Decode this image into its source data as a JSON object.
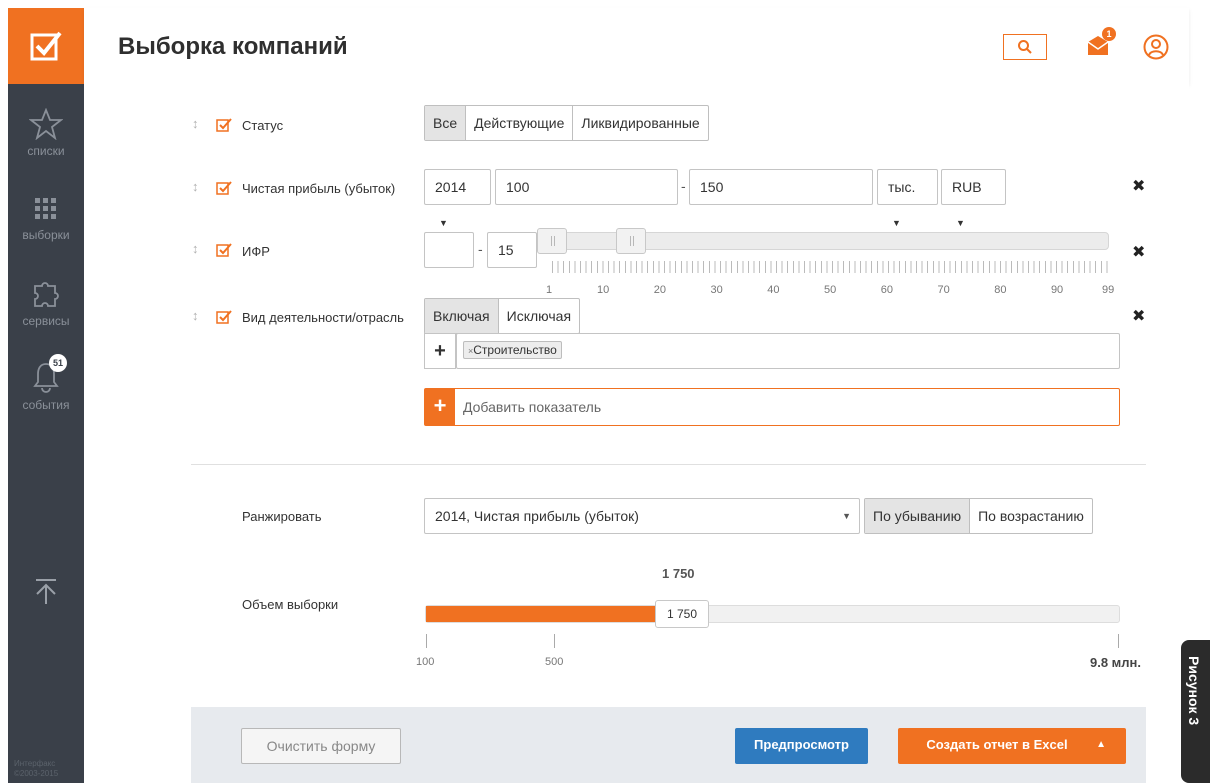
{
  "sidebar": {
    "items": [
      {
        "label": "списки",
        "icon": "star-icon"
      },
      {
        "label": "выборки",
        "icon": "grid-icon"
      },
      {
        "label": "сервисы",
        "icon": "puzzle-icon"
      },
      {
        "label": "события",
        "icon": "bell-icon",
        "badge": "51"
      }
    ],
    "footer_line1": "Интерфакс",
    "footer_line2": "©2003-2015"
  },
  "header": {
    "title": "Выборка компаний",
    "mail_badge": "1"
  },
  "filters": {
    "status": {
      "label": "Статус",
      "options": [
        "Все",
        "Действующие",
        "Ликвидированные"
      ],
      "selected": "Все"
    },
    "profit": {
      "label": "Чистая прибыль (убыток)",
      "year": "2014",
      "from": "100",
      "to": "150",
      "unit": "тыс.",
      "currency": "RUB"
    },
    "ifr": {
      "label": "ИФР",
      "from": "",
      "to": "15",
      "range_min": 1,
      "range_max": 99,
      "low": 1,
      "high": 15,
      "tick_labels": [
        "1",
        "10",
        "20",
        "30",
        "40",
        "50",
        "60",
        "70",
        "80",
        "90",
        "99"
      ]
    },
    "activity": {
      "label": "Вид деятельности/отрасль",
      "options": [
        "Включая",
        "Исключая"
      ],
      "selected": "Включая",
      "tags": [
        "Строительство"
      ]
    },
    "add_placeholder": "Добавить показатель"
  },
  "ranking": {
    "label": "Ранжировать",
    "selected": "2014, Чистая прибыль (убыток)",
    "order_options": [
      "По убыванию",
      "По возрастанию"
    ],
    "order_selected": "По убыванию"
  },
  "volume": {
    "label": "Объем выборки",
    "value": "1 750",
    "top_value": "1 750",
    "fill_fraction": 0.37,
    "min_label": "100",
    "mid_label": "500",
    "max_label": "9.8 млн."
  },
  "footer": {
    "clear_label": "Очистить форму",
    "preview_label": "Предпросмотр",
    "excel_label": "Создать отчет в Excel"
  },
  "figure_label": "Рисунок 3",
  "colors": {
    "accent": "#f07121",
    "sidebar": "#3a4049",
    "primary_button": "#2f7bbf"
  }
}
